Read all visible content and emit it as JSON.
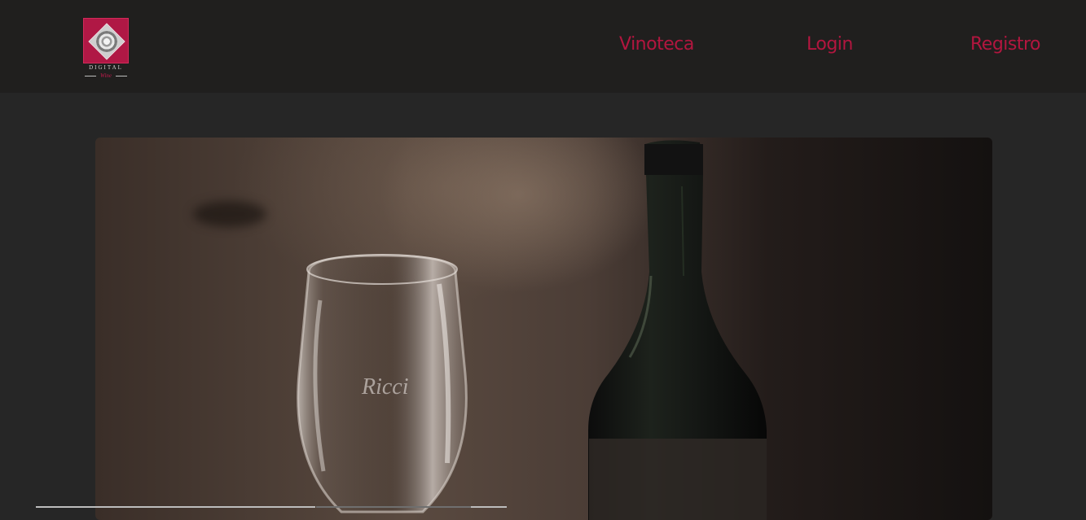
{
  "header": {
    "logo": {
      "text_top": "DIGITAL",
      "text_script": "Wine",
      "icon": "diamond-emblem"
    },
    "nav": {
      "items": [
        {
          "label": "Vinoteca"
        },
        {
          "label": "Login"
        },
        {
          "label": "Registro"
        }
      ],
      "color": "#b2163f"
    }
  },
  "hero": {
    "image": "wine-glass-and-bottle-photo",
    "glass_engraving": "Ricci"
  },
  "colors": {
    "background": "#262626",
    "header_background": "#201f1e",
    "accent": "#b2163f"
  }
}
